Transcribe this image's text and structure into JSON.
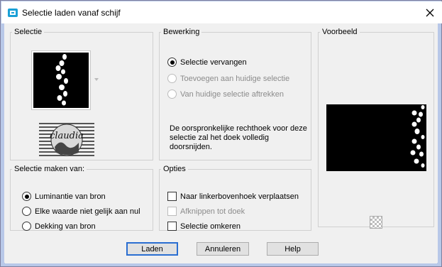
{
  "window": {
    "title": "Selectie laden vanaf schijf"
  },
  "selectie": {
    "legend": "Selectie",
    "logo_text": "claudia"
  },
  "bewerking": {
    "legend": "Bewerking",
    "options": [
      {
        "label": "Selectie vervangen",
        "selected": true,
        "enabled": true
      },
      {
        "label": "Toevoegen aan huidige selectie",
        "selected": false,
        "enabled": false
      },
      {
        "label": "Van huidige selectie aftrekken",
        "selected": false,
        "enabled": false
      }
    ],
    "note": "De oorspronkelijke rechthoek voor deze selectie zal het doek volledig doorsnijden."
  },
  "voorbeeld": {
    "legend": "Voorbeeld"
  },
  "maken": {
    "legend": "Selectie maken van:",
    "options": [
      {
        "label": "Luminantie van bron",
        "selected": true
      },
      {
        "label": "Elke waarde niet gelijk aan nul",
        "selected": false
      },
      {
        "label": "Dekking van bron",
        "selected": false
      }
    ]
  },
  "opties": {
    "legend": "Opties",
    "checks": [
      {
        "label": "Naar linkerbovenhoek verplaatsen",
        "checked": false,
        "enabled": true
      },
      {
        "label": "Afknippen tot doek",
        "checked": false,
        "enabled": false
      },
      {
        "label": "Selectie omkeren",
        "checked": false,
        "enabled": true
      }
    ]
  },
  "buttons": {
    "load": "Laden",
    "cancel": "Annuleren",
    "help": "Help"
  }
}
